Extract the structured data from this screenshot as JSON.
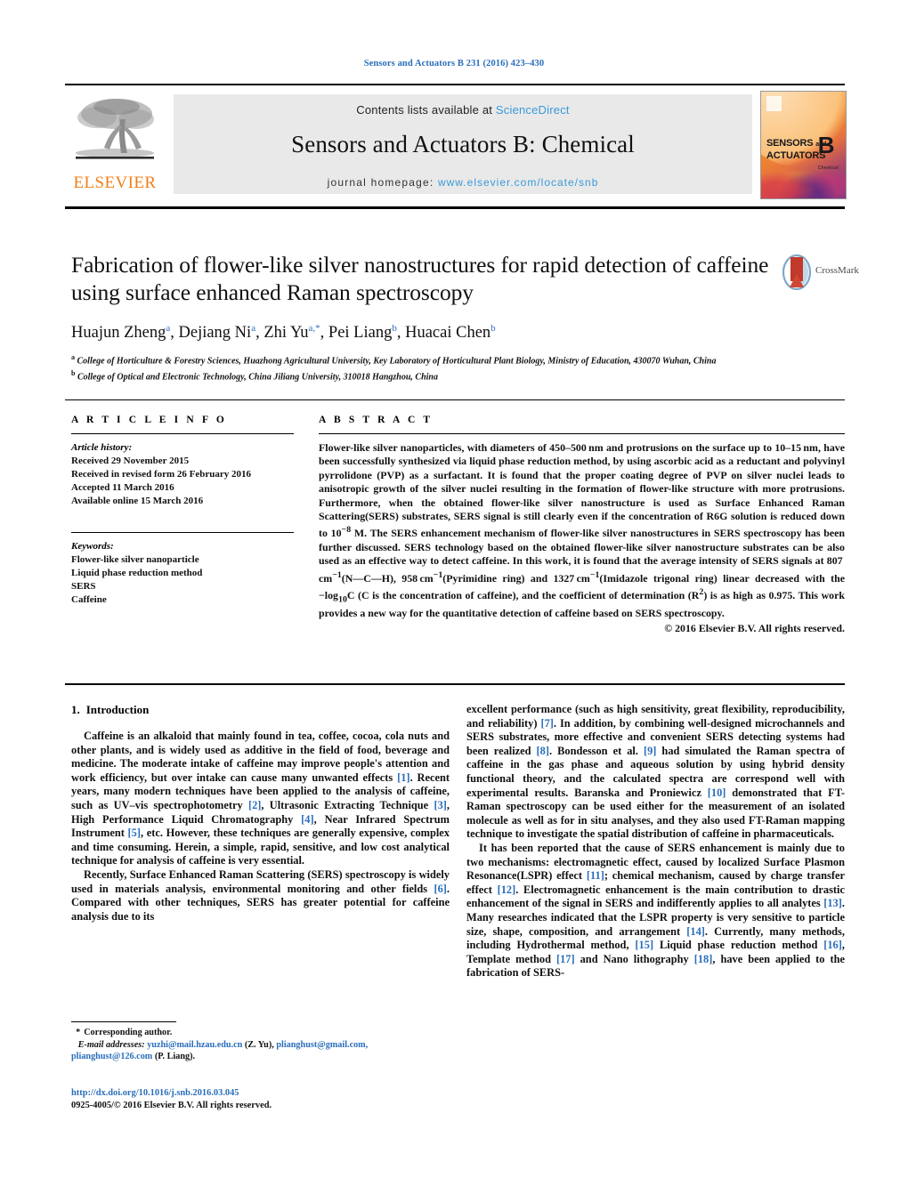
{
  "running_head": "Sensors and Actuators B 231 (2016) 423–430",
  "masthead": {
    "contents_prefix": "Contents lists available at",
    "sciencedirect": "ScienceDirect",
    "journal_title": "Sensors and Actuators B: Chemical",
    "homepage_prefix": "journal homepage:",
    "homepage_url": "www.elsevier.com/locate/snb",
    "publisher": "ELSEVIER",
    "cover": {
      "line1": "SENSORS",
      "and": "and",
      "line2": "ACTUATORS",
      "volume_letter": "B",
      "volume_sub": "Chemical"
    },
    "link_color": "#3a9ad9"
  },
  "article": {
    "title": "Fabrication of flower-like silver nanostructures for rapid detection of caffeine using surface enhanced Raman spectroscopy",
    "authors_html": "Huajun Zheng<sup>a</sup>, Dejiang Ni<sup>a</sup>, Zhi Yu<sup>a,*</sup>, Pei Liang<sup>b</sup>, Huacai Chen<sup>b</sup>",
    "affiliation_a": "College of Horticulture & Forestry Sciences, Huazhong Agricultural University, Key Laboratory of Horticultural Plant Biology, Ministry of Education, 430070 Wuhan, China",
    "affiliation_b": "College of Optical and Electronic Technology, China Jiliang University, 310018 Hangzhou, China",
    "crossmark_label": "CrossMark"
  },
  "article_info": {
    "heading": "A R T I C L E    I N F O",
    "history_label": "Article history:",
    "history": [
      "Received 29 November 2015",
      "Received in revised form 26 February 2016",
      "Accepted 11 March 2016",
      "Available online 15 March 2016"
    ],
    "keywords_label": "Keywords:",
    "keywords": [
      "Flower-like silver nanoparticle",
      "Liquid phase reduction method",
      "SERS",
      "Caffeine"
    ]
  },
  "abstract": {
    "heading": "A B S T R A C T",
    "text_html": "Flower-like silver nanoparticles, with diameters of 450–500&thinsp;nm and protrusions on the surface up to 10–15&thinsp;nm, have been successfully synthesized via liquid phase reduction method, by using ascorbic acid as a reductant and polyvinyl pyrrolidone (PVP) as a surfactant. It is found that the proper coating degree of PVP on silver nuclei leads to anisotropic growth of the silver nuclei resulting in the formation of flower-like structure with more protrusions. Furthermore, when the obtained flower-like silver nanostructure is used as Surface Enhanced Raman Scattering(SERS) substrates, SERS signal is still clearly even if the concentration of R6G solution is reduced down to 10<sup>−8</sup> M. The SERS enhancement mechanism of flower-like silver nanostructures in SERS spectroscopy has been further discussed. SERS technology based on the obtained flower-like silver nanostructure substrates can be also used as an effective way to detect caffeine. In this work, it is found that the average intensity of SERS signals at 807&thinsp;cm<sup>−1</sup>(N—C—H), 958&thinsp;cm<sup>−1</sup>(Pyrimidine ring) and 1327&thinsp;cm<sup>−1</sup>(Imidazole trigonal ring) linear decreased with the −log<sub>10</sub>C (C is the concentration of caffeine), and the coefficient of determination (R<sup>2</sup>) is as high as 0.975. This work provides a new way for the quantitative detection of caffeine based on SERS spectroscopy.",
    "copyright": "© 2016 Elsevier B.V. All rights reserved."
  },
  "body": {
    "section_number": "1.",
    "section_title": "Introduction",
    "left_paragraphs_html": [
      "Caffeine is an alkaloid that mainly found in tea, coffee, cocoa, cola nuts and other plants, and is widely used as additive in the field of food, beverage and medicine. The moderate intake of caffeine may improve people's attention and work efficiency, but over intake can cause many unwanted effects <span class=\"ref\">[1]</span>. Recent years, many modern techniques have been applied to the analysis of caffeine, such as UV–vis spectrophotometry <span class=\"ref\">[2]</span>, Ultrasonic Extracting Technique <span class=\"ref\">[3]</span>, High Performance Liquid Chromatography <span class=\"ref\">[4]</span>, Near Infrared Spectrum Instrument <span class=\"ref\">[5]</span>, etc. However, these techniques are generally expensive, complex and time consuming. Herein, a simple, rapid, sensitive, and low cost analytical technique for analysis of caffeine is very essential.",
      "Recently, Surface Enhanced Raman Scattering (SERS) spectroscopy is widely used in materials analysis, environmental monitoring and other fields <span class=\"ref\">[6]</span>. Compared with other techniques, SERS has greater potential for caffeine analysis due to its"
    ],
    "right_paragraphs_html": [
      "excellent performance (such as high sensitivity, great flexibility, reproducibility, and reliability) <span class=\"ref\">[7]</span>. In addition, by combining well-designed microchannels and SERS substrates, more effective and convenient SERS detecting systems had been realized <span class=\"ref\">[8]</span>. Bondesson et al. <span class=\"ref\">[9]</span> had simulated the Raman spectra of caffeine in the gas phase and aqueous solution by using hybrid density functional theory, and the calculated spectra are correspond well with experimental results. Baranska and Proniewicz <span class=\"ref\">[10]</span> demonstrated that FT-Raman spectroscopy can be used either for the measurement of an isolated molecule as well as for in situ analyses, and they also used FT-Raman mapping technique to investigate the spatial distribution of caffeine in pharmaceuticals.",
      "It has been reported that the cause of SERS enhancement is mainly due to two mechanisms: electromagnetic effect, caused by localized Surface Plasmon Resonance(LSPR) effect <span class=\"ref\">[11]</span>; chemical mechanism, caused by charge transfer effect <span class=\"ref\">[12]</span>. Electromagnetic enhancement is the main contribution to drastic enhancement of the signal in SERS and indifferently applies to all analytes <span class=\"ref\">[13]</span>. Many researches indicated that the LSPR property is very sensitive to particle size, shape, composition, and arrangement <span class=\"ref\">[14]</span>. Currently, many methods, including Hydrothermal method, <span class=\"ref\">[15]</span> Liquid phase reduction method <span class=\"ref\">[16]</span>, Template method <span class=\"ref\">[17]</span> and Nano lithography <span class=\"ref\">[18]</span>, have been applied to the fabrication of SERS-"
    ]
  },
  "footnote": {
    "corresponding_star": "*",
    "corresponding_text": "Corresponding author.",
    "email_label": "E-mail addresses:",
    "email_1": "yuzhi@mail.hzau.edu.cn",
    "email_1_owner": "(Z. Yu),",
    "email_2": "plianghust@gmail.com,",
    "email_3": "plianghust@126.com",
    "email_3_owner": "(P. Liang)."
  },
  "footer": {
    "doi": "http://dx.doi.org/10.1016/j.snb.2016.03.045",
    "issn_line": "0925-4005/© 2016 Elsevier B.V. All rights reserved."
  }
}
